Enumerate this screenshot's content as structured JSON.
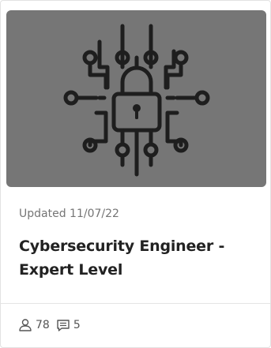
{
  "card": {
    "image_icon": "cybersecurity-lock-circuit-icon",
    "updated": "Updated 11/07/22",
    "title": "Cybersecurity Engineer - Expert Level",
    "stats": {
      "members_icon": "user-icon",
      "members": "78",
      "comments_icon": "comment-icon",
      "comments": "5"
    }
  },
  "colors": {
    "thumbnail_bg": "#767676",
    "icon_stroke": "#1e1e1e",
    "title": "#222222",
    "meta": "#757575"
  }
}
